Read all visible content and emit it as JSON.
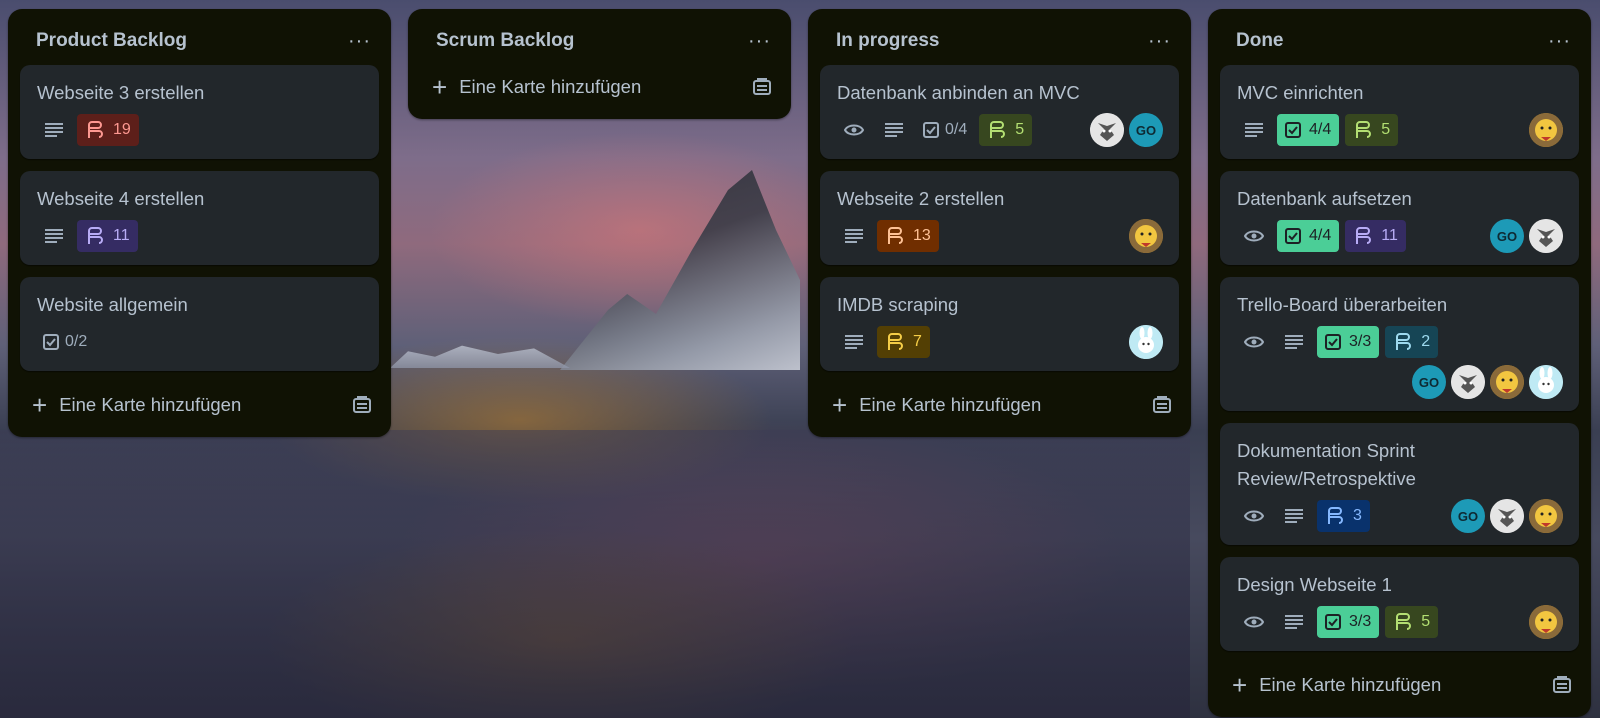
{
  "lists": [
    {
      "title": "Product Backlog",
      "add_label": "Eine Karte hinzufügen",
      "cards": [
        {
          "title": "Webseite 3 erstellen",
          "points": "19",
          "points_bg": "#5d1f1a",
          "points_fg": "#fd9891"
        },
        {
          "title": "Webseite 4 erstellen",
          "points": "11",
          "points_bg": "#352c63",
          "points_fg": "#b8acf6"
        },
        {
          "title": "Website allgemein",
          "checklist": "0/2"
        }
      ]
    },
    {
      "title": "Scrum Backlog",
      "add_label": "Eine Karte hinzufügen",
      "cards": []
    },
    {
      "title": "In progress",
      "add_label": "Eine Karte hinzufügen",
      "cards": [
        {
          "title": "Datenbank anbinden an MVC",
          "checklist": "0/4",
          "points": "5",
          "points_bg": "#37471f",
          "points_fg": "#b3df72",
          "avatars": [
            "wolf",
            "GO"
          ]
        },
        {
          "title": "Webseite 2 erstellen",
          "points": "13",
          "points_bg": "#702e00",
          "points_fg": "#fec195",
          "avatars": [
            "bear"
          ]
        },
        {
          "title": "IMDB scraping",
          "points": "7",
          "points_bg": "#533f04",
          "points_fg": "#f5cd47",
          "avatars": [
            "bunny"
          ]
        }
      ]
    },
    {
      "title": "Done",
      "add_label": "Eine Karte hinzufügen",
      "cards": [
        {
          "title": "MVC einrichten",
          "checklist": "4/4",
          "points": "5",
          "points_bg": "#37471f",
          "points_fg": "#b3df72",
          "avatars": [
            "bear"
          ]
        },
        {
          "title": "Datenbank aufsetzen",
          "checklist": "4/4",
          "points": "11",
          "points_bg": "#352c63",
          "points_fg": "#b8acf6",
          "avatars": [
            "GO",
            "wolf"
          ]
        },
        {
          "title": "Trello-Board überarbeiten",
          "checklist": "3/3",
          "points": "2",
          "points_bg": "#164555",
          "points_fg": "#9dd9ee",
          "avatars": [
            "GO",
            "wolf",
            "bear",
            "bunny"
          ]
        },
        {
          "title": "Dokumentation Sprint Review/Retrospektive",
          "points": "3",
          "points_bg": "#09326c",
          "points_fg": "#85b8ff",
          "avatars": [
            "GO",
            "wolf",
            "bear"
          ]
        },
        {
          "title": "Design Webseite 1",
          "checklist": "3/3",
          "points": "5",
          "points_bg": "#37471f",
          "points_fg": "#b3df72",
          "avatars": [
            "bear"
          ]
        }
      ]
    }
  ],
  "avatar_initials": "GO",
  "colors": {
    "list_bg": "#101204",
    "card_bg": "#22272b",
    "checklist_done_bg": "#4bce97",
    "checklist_done_fg": "#1d2125"
  }
}
